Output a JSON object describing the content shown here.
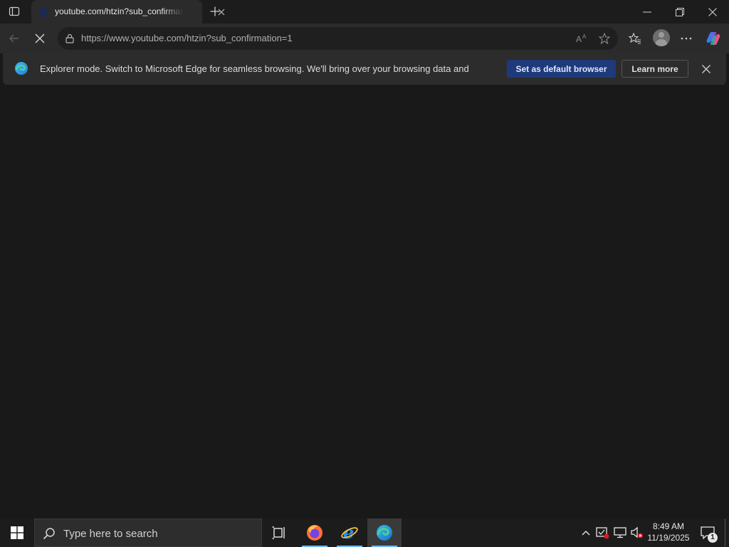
{
  "browser": {
    "tab": {
      "title": "youtube.com/htzin?sub_confirmation=1",
      "favicon": "ie-mode-icon"
    },
    "url": "https://www.youtube.com/htzin?sub_confirmation=1",
    "loading": true
  },
  "infobar": {
    "message": "Explorer mode. Switch to Microsoft Edge for seamless browsing. We'll bring over your browsing data and",
    "primary_button": "Set as default browser",
    "secondary_button": "Learn more"
  },
  "taskbar": {
    "search_placeholder": "Type here to search",
    "apps": [
      "task-view-icon",
      "firefox-icon",
      "internet-explorer-icon",
      "edge-icon"
    ],
    "clock": {
      "time": "8:49 AM",
      "date": "11/19/2025"
    },
    "notification_count": "1"
  },
  "colors": {
    "background": "#191919",
    "toolbar": "#2b2b2b",
    "primary_button": "#1f3a7a",
    "taskbar_accent": "#6cb8f6"
  }
}
